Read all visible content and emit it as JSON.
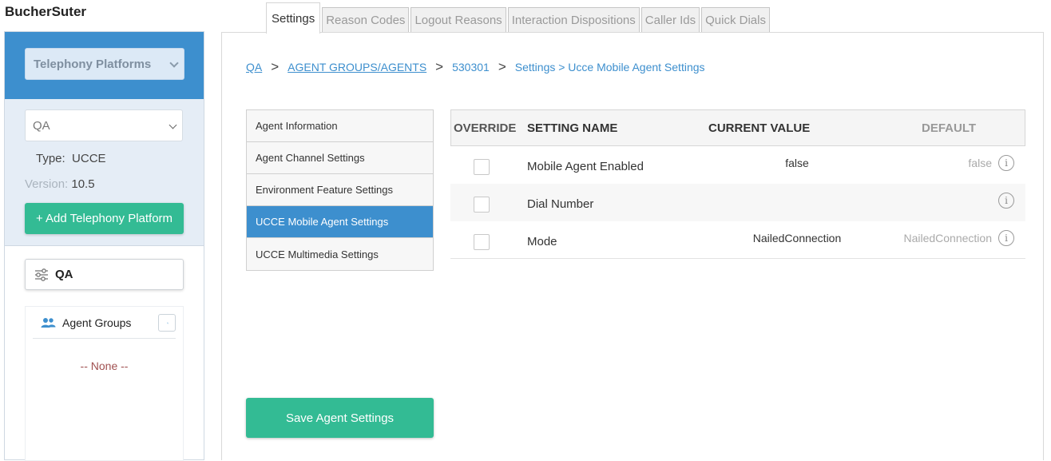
{
  "app": {
    "brand": "BucherSuter"
  },
  "sidebar": {
    "platform_select": "Telephony Platforms",
    "instance_select": "QA",
    "type_label": "Type:",
    "type_value": "UCCE",
    "version_label": "Version:",
    "version_value": "10.5",
    "add_button": "+ Add Telephony Platform",
    "filter_chip": "QA",
    "groups_title": "Agent Groups",
    "groups_empty": "-- None --"
  },
  "tabs": [
    {
      "label": "Settings",
      "active": true
    },
    {
      "label": "Reason Codes"
    },
    {
      "label": "Logout Reasons"
    },
    {
      "label": "Interaction Dispositions"
    },
    {
      "label": "Caller Ids"
    },
    {
      "label": "Quick Dials"
    }
  ],
  "breadcrumb": {
    "part1": "QA",
    "sep": ">",
    "part2": "AGENT GROUPS/AGENTS",
    "part3": "530301",
    "part4": "Settings > Ucce Mobile Agent Settings"
  },
  "nav": [
    "Agent Information",
    "Agent Channel Settings",
    "Environment Feature Settings",
    "UCCE Mobile Agent Settings",
    "UCCE Multimedia Settings"
  ],
  "table": {
    "headers": {
      "override": "OVERRIDE",
      "name": "SETTING NAME",
      "current": "CURRENT VALUE",
      "default": "DEFAULT"
    },
    "rows": [
      {
        "name": "Mobile Agent Enabled",
        "current": "false",
        "default": "false"
      },
      {
        "name": "Dial Number",
        "current": "",
        "default": ""
      },
      {
        "name": "Mode",
        "current": "NailedConnection",
        "default": "NailedConnection"
      }
    ],
    "info_glyph": "i"
  },
  "actions": {
    "save": "Save Agent Settings"
  },
  "colors": {
    "accent_blue": "#3d8fce",
    "accent_green": "#33bb94"
  }
}
